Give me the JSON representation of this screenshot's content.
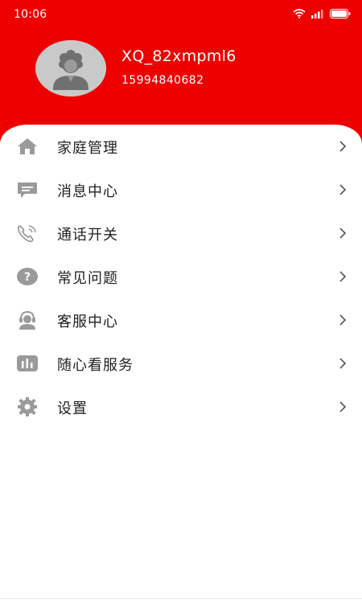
{
  "status_bar": {
    "time": "10:06",
    "icons": [
      "wifi-icon",
      "signal-icon",
      "battery-icon"
    ]
  },
  "profile": {
    "avatar_icon": "user-avatar-icon",
    "username": "XQ_82xmpml6",
    "phone": "15994840682"
  },
  "menu": {
    "items": [
      {
        "label": "家庭管理",
        "icon": "home-icon"
      },
      {
        "label": "消息中心",
        "icon": "message-icon"
      },
      {
        "label": "通话开关",
        "icon": "phone-call-icon"
      },
      {
        "label": "常见问题",
        "icon": "question-icon"
      },
      {
        "label": "客服中心",
        "icon": "customer-service-icon"
      },
      {
        "label": "随心看服务",
        "icon": "chart-service-icon"
      },
      {
        "label": "设置",
        "icon": "gear-icon"
      }
    ]
  },
  "colors": {
    "header_background": "#ee0000",
    "icon_gray": "#9a9a9a",
    "text": "#222222"
  }
}
